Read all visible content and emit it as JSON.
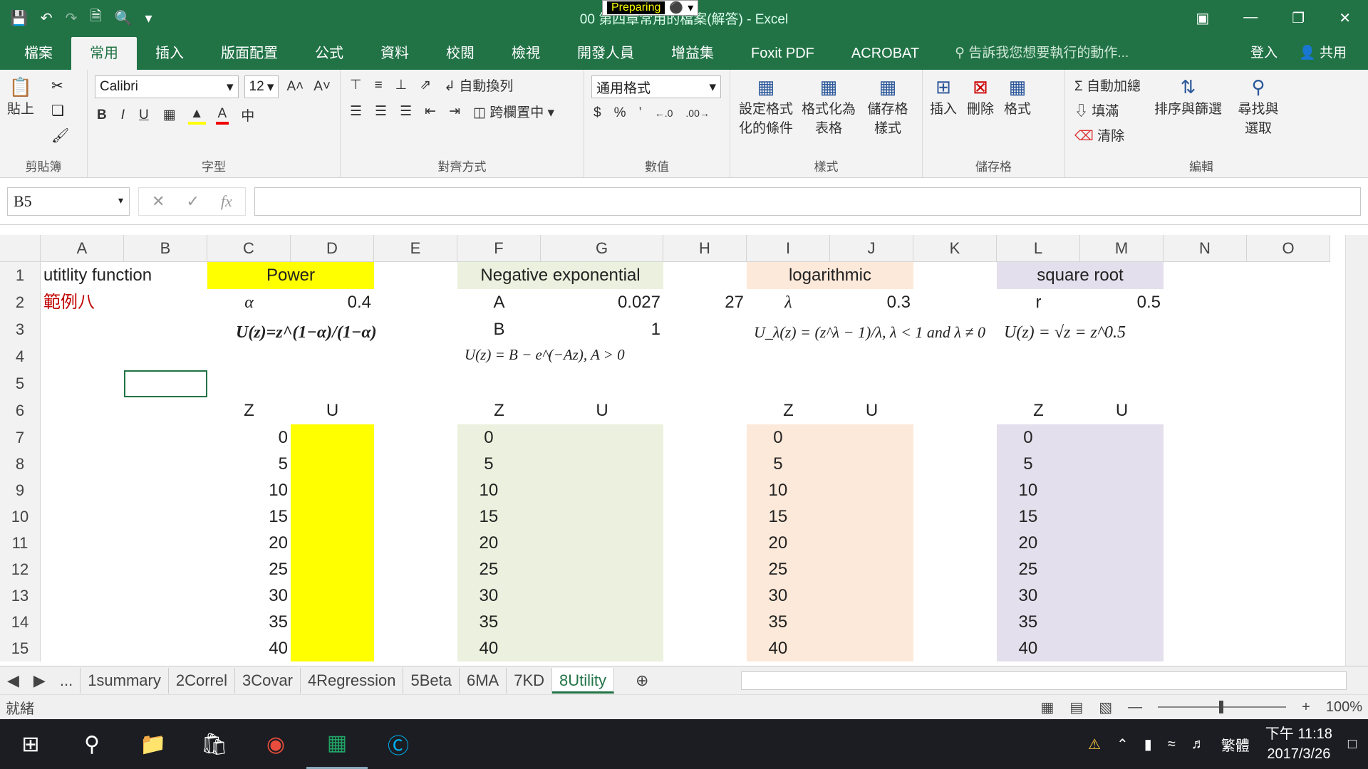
{
  "window": {
    "title": "00 第四章常用的檔案(解答) - Excel",
    "preparing": "Preparing",
    "qat": [
      "save-icon",
      "undo-icon",
      "redo-icon",
      "new-icon",
      "print-preview-icon",
      "customize-icon"
    ]
  },
  "tabs": [
    "檔案",
    "常用",
    "插入",
    "版面配置",
    "公式",
    "資料",
    "校閱",
    "檢視",
    "開發人員",
    "增益集",
    "Foxit PDF",
    "ACROBAT"
  ],
  "active_tab": "常用",
  "tellme": "告訴我您想要執行的動作...",
  "signin": "登入",
  "share": "共用",
  "ribbon": {
    "clipboard": {
      "paste": "貼上",
      "label": "剪貼簿"
    },
    "font": {
      "name": "Calibri",
      "size": "12",
      "label": "字型",
      "B": "B",
      "I": "I",
      "U": "U"
    },
    "align": {
      "wrap": "自動換列",
      "merge": "跨欄置中",
      "label": "對齊方式"
    },
    "number": {
      "format": "通用格式",
      "label": "數值",
      "currency": "$",
      "percent": "%",
      "comma": "’"
    },
    "styles": {
      "cond": "設定格式化的條件",
      "table": "格式化為表格",
      "cell": "儲存格樣式",
      "label": "樣式"
    },
    "cells": {
      "insert": "插入",
      "delete": "刪除",
      "format": "格式",
      "label": "儲存格"
    },
    "editing": {
      "autosum": "自動加總",
      "fill": "填滿",
      "clear": "清除",
      "sort": "排序與篩選",
      "find": "尋找與選取",
      "label": "編輯"
    }
  },
  "formula_bar": {
    "name_box": "B5",
    "fx": "fx",
    "value": ""
  },
  "columns": [
    "A",
    "B",
    "C",
    "D",
    "E",
    "F",
    "G",
    "H",
    "I",
    "J",
    "K",
    "L",
    "M",
    "N",
    "O"
  ],
  "rows": [
    "1",
    "2",
    "3",
    "4",
    "5",
    "6",
    "7",
    "8",
    "9",
    "10",
    "11",
    "12",
    "13",
    "14",
    "15"
  ],
  "cells": {
    "A1": "utitlity function",
    "A2": "範例八",
    "C1": "Power",
    "C2": "α",
    "D2": "0.4",
    "F1": "Negative exponential",
    "F2": "A",
    "G2": "0.027",
    "F3": "B",
    "G3": "1",
    "H2": "27",
    "I1": "logarithmic",
    "I2": "λ",
    "J2": "0.3",
    "L1": "square root",
    "L2": "r",
    "M2": "0.5",
    "C6": "Z",
    "D6": "U",
    "F6": "Z",
    "G6": "U",
    "I6": "Z",
    "J6": "U",
    "L6": "Z",
    "M6": "U"
  },
  "formulas": {
    "power": "U(z)=z^(1−α)/(1−α)",
    "negexp": "U(z) = B − e^(−Az), A > 0",
    "log": "U_λ(z) = (z^λ − 1)/λ, λ < 1 and λ ≠ 0",
    "sqrt": "U(z) = √z = z^0.5"
  },
  "z_values": [
    "0",
    "5",
    "10",
    "15",
    "20",
    "25",
    "30",
    "35",
    "40"
  ],
  "colors": {
    "yellow": "#ffff00",
    "green": "#ebf1de",
    "peach": "#fde9d9",
    "lavender": "#e4dfec",
    "excel": "#217346",
    "red": "#c00000"
  },
  "sheet_tabs": [
    "...",
    "1summary",
    "2Correl",
    "3Covar",
    "4Regression",
    "5Beta",
    "6MA",
    "7KD",
    "8Utility"
  ],
  "active_sheet": "8Utility",
  "status": {
    "ready": "就緒",
    "zoom": "100%"
  },
  "clock": {
    "time": "下午 11:18",
    "date": "2017/3/26",
    "ime": "繁體"
  }
}
